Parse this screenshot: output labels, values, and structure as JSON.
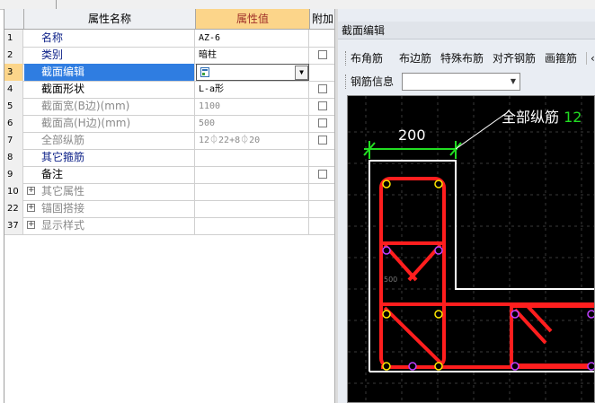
{
  "grid": {
    "headers": {
      "num": "",
      "name": "属性名称",
      "value": "属性值",
      "extra": "附加"
    },
    "rows": [
      {
        "num": "1",
        "name": "名称",
        "value": "AZ-6",
        "style": "blue",
        "checkbox": false,
        "expand": false
      },
      {
        "num": "2",
        "name": "类别",
        "value": "暗柱",
        "style": "blue",
        "checkbox": true,
        "expand": false
      },
      {
        "num": "3",
        "name": "截面编辑",
        "value": "",
        "style": "selected",
        "checkbox": false,
        "expand": false
      },
      {
        "num": "4",
        "name": "截面形状",
        "value": "L-a形",
        "style": "black",
        "checkbox": true,
        "expand": false
      },
      {
        "num": "5",
        "name": "截面宽(B边)(mm)",
        "value": "1100",
        "style": "gray",
        "checkbox": true,
        "expand": false
      },
      {
        "num": "6",
        "name": "截面高(H边)(mm)",
        "value": "500",
        "style": "gray",
        "checkbox": true,
        "expand": false
      },
      {
        "num": "7",
        "name": "全部纵筋",
        "value": "12⏀22+8⏀20",
        "style": "gray",
        "checkbox": true,
        "expand": false
      },
      {
        "num": "8",
        "name": "其它箍筋",
        "value": "",
        "style": "blue",
        "checkbox": false,
        "expand": false
      },
      {
        "num": "9",
        "name": "备注",
        "value": "",
        "style": "black",
        "checkbox": true,
        "expand": false
      },
      {
        "num": "10",
        "name": "其它属性",
        "value": "",
        "style": "group",
        "checkbox": false,
        "expand": true
      },
      {
        "num": "22",
        "name": "锚固搭接",
        "value": "",
        "style": "group",
        "checkbox": false,
        "expand": true
      },
      {
        "num": "37",
        "name": "显示样式",
        "value": "",
        "style": "group",
        "checkbox": false,
        "expand": true
      }
    ]
  },
  "panel": {
    "title": "截面编辑",
    "toolbar": [
      "布角筋",
      "布边筋",
      "特殊布筋",
      "对齐钢筋",
      "画箍筋"
    ],
    "rebar_info_label": "钢筋信息",
    "rebar_info_value": "",
    "canvas": {
      "dimension": "200",
      "all_rebar_label": "全部纵筋",
      "all_rebar_value": "12",
      "side_dim": "500",
      "colors": {
        "background": "#000000",
        "outline": "#ffffff",
        "stirrup": "#ff1e1e",
        "dimension": "#22dd22",
        "rebar_corner": "#ffe800",
        "rebar_side": "#c040ff"
      }
    }
  }
}
